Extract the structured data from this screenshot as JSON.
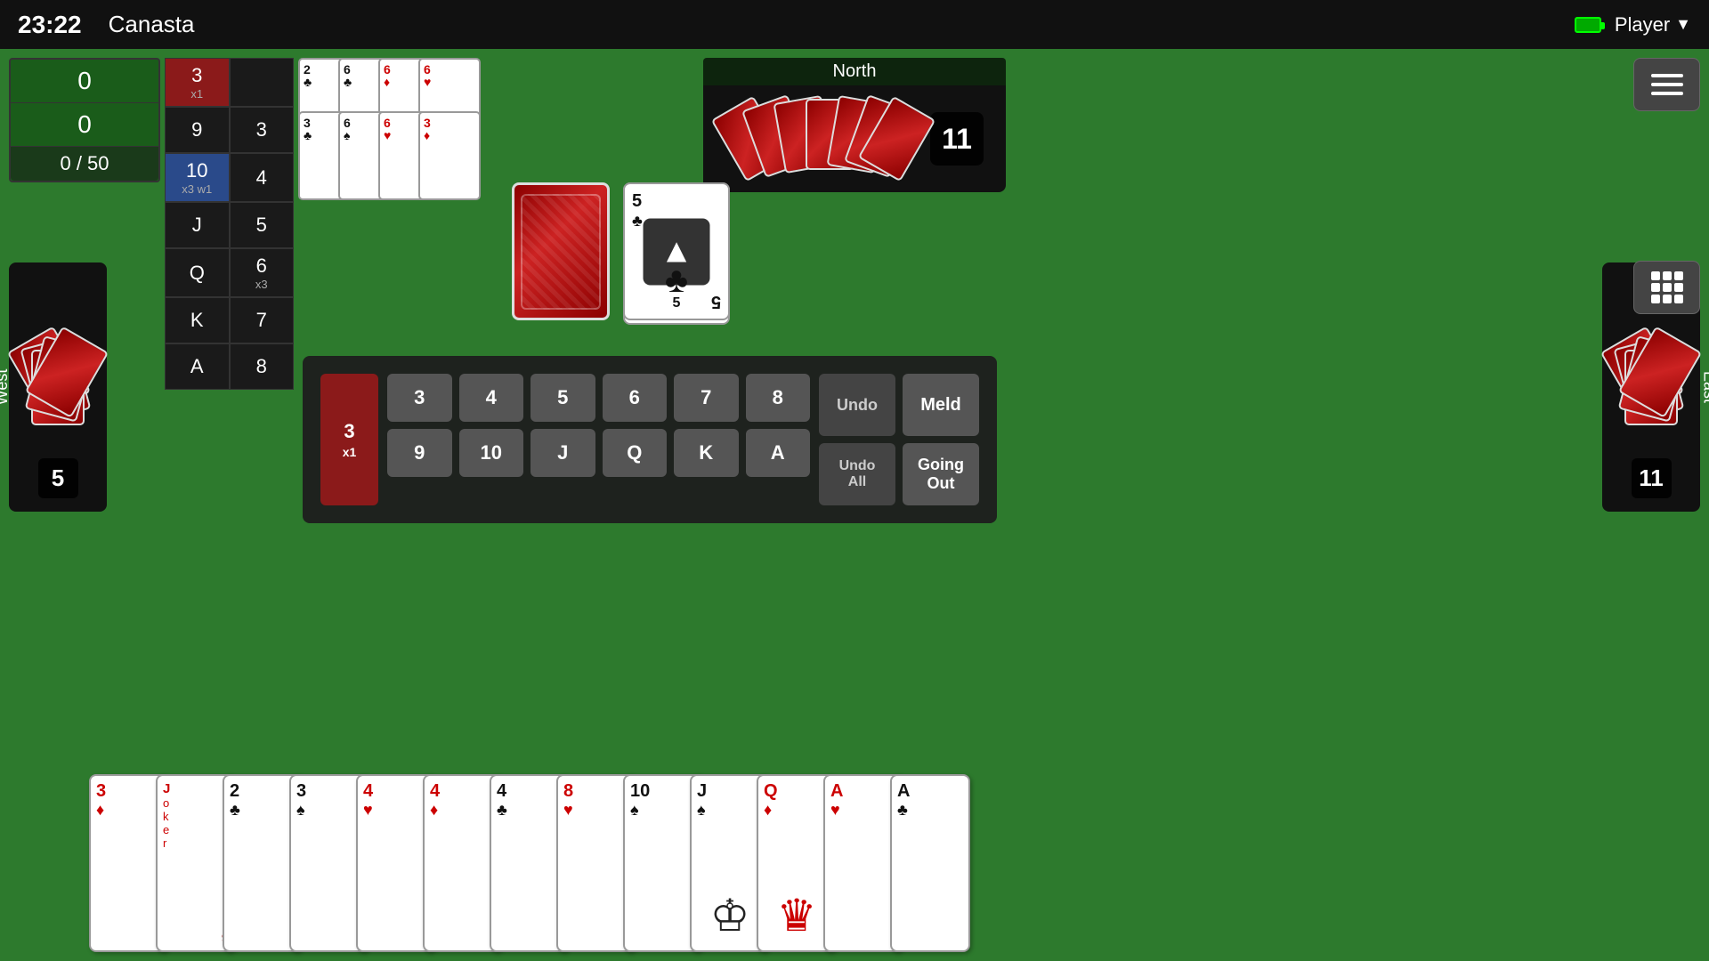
{
  "topbar": {
    "time": "23:22",
    "app_title": "Canasta",
    "player_label": "Player"
  },
  "score_panel": {
    "score1": "0",
    "score2": "0",
    "progress": "0 / 50"
  },
  "card_table": {
    "rows": [
      {
        "left": "3",
        "right": "x1",
        "left_highlight": "red",
        "right_highlight": "none"
      },
      {
        "left": "9",
        "right": "3",
        "left_highlight": "none",
        "right_highlight": "none"
      },
      {
        "left": "10",
        "right": "4",
        "left_highlight": "blue",
        "right_highlight": "none"
      },
      {
        "left": "x3 w1",
        "right": "",
        "left_highlight": "blue_sub",
        "right_highlight": "none"
      },
      {
        "left": "J",
        "right": "5",
        "left_highlight": "none",
        "right_highlight": "none"
      },
      {
        "left": "Q",
        "right": "6",
        "left_highlight": "none",
        "right_highlight": "none"
      },
      {
        "left": "",
        "right": "x3",
        "left_highlight": "none",
        "right_highlight": "none_sub"
      },
      {
        "left": "K",
        "right": "7",
        "left_highlight": "none",
        "right_highlight": "none"
      },
      {
        "left": "A",
        "right": "8",
        "left_highlight": "none",
        "right_highlight": "none"
      }
    ]
  },
  "north": {
    "label": "North",
    "count": "11"
  },
  "west": {
    "label": "West",
    "count": "5"
  },
  "east": {
    "label": "East",
    "count": "11"
  },
  "discard": {
    "value": "5",
    "suit": "♣"
  },
  "action_panel": {
    "row1_buttons": [
      "3",
      "4",
      "5",
      "6",
      "7",
      "8"
    ],
    "row2_buttons": [
      "9",
      "10",
      "J",
      "Q",
      "K",
      "A"
    ],
    "selected": "3",
    "selected_count": "x1",
    "undo_label": "Undo",
    "meld_label": "Meld",
    "undo_all_label": "Undo All",
    "going_out_label": "Going Out"
  },
  "player_hand": {
    "cards": [
      {
        "value": "3",
        "suit": "♦",
        "color": "red"
      },
      {
        "value": "J",
        "suit": "Joker",
        "color": "red",
        "joker": true
      },
      {
        "value": "2",
        "suit": "♣",
        "color": "black"
      },
      {
        "value": "3",
        "suit": "♠",
        "color": "black"
      },
      {
        "value": "4",
        "suit": "♥",
        "color": "red"
      },
      {
        "value": "4",
        "suit": "♦",
        "color": "red"
      },
      {
        "value": "4",
        "suit": "♣",
        "color": "black"
      },
      {
        "value": "8",
        "suit": "♥",
        "color": "red"
      },
      {
        "value": "10",
        "suit": "♠",
        "color": "black"
      },
      {
        "value": "J",
        "suit": "♠",
        "color": "black"
      },
      {
        "value": "Q",
        "suit": "♦",
        "color": "red"
      },
      {
        "value": "A",
        "suit": "♥",
        "color": "red"
      },
      {
        "value": "A",
        "suit": "♣",
        "color": "black"
      }
    ]
  },
  "top_cards": [
    {
      "value": "2",
      "suit": "♣",
      "color": "black"
    },
    {
      "value": "6",
      "suit": "♣",
      "color": "black"
    },
    {
      "value": "6",
      "suit": "♦",
      "color": "red"
    },
    {
      "value": "6",
      "suit": "♥",
      "color": "red"
    },
    {
      "value": "6",
      "suit": "♠",
      "color": "black"
    }
  ],
  "canasta_cards": [
    {
      "value": "3",
      "suit": "♣",
      "color": "black"
    }
  ]
}
